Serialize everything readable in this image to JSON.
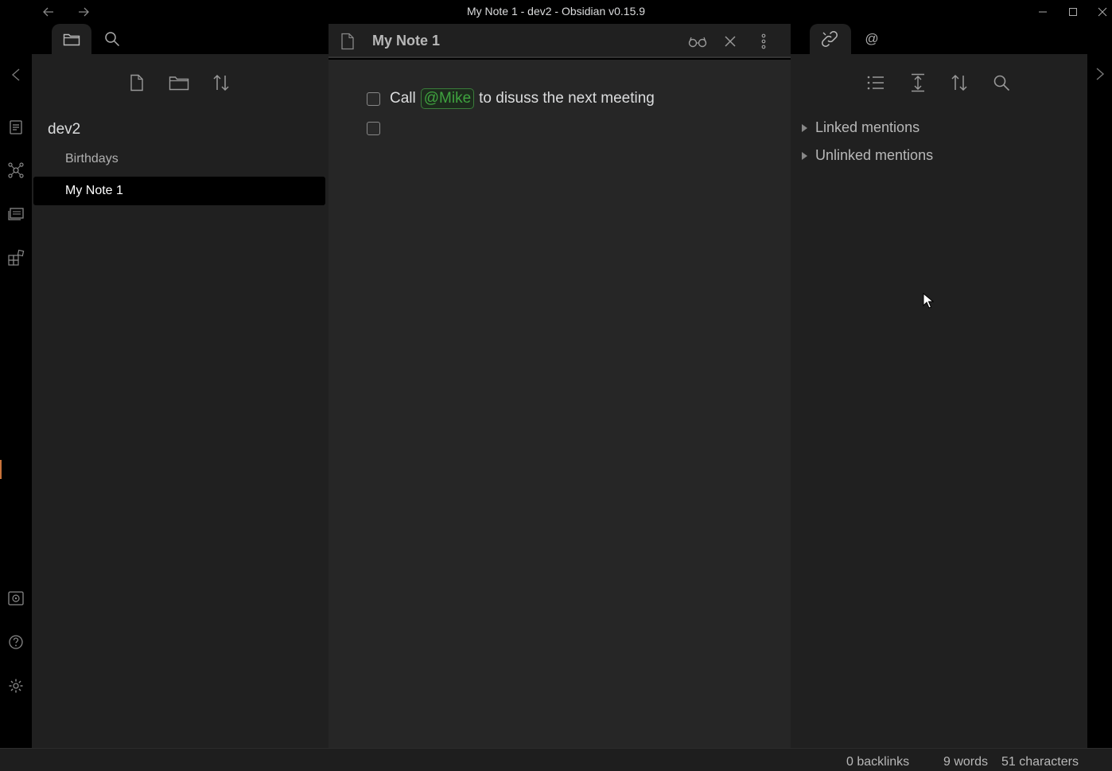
{
  "window": {
    "title": "My Note 1 - dev2 - Obsidian v0.15.9"
  },
  "vault": {
    "name": "dev2",
    "files": [
      {
        "name": "Birthdays",
        "active": false
      },
      {
        "name": "My Note 1",
        "active": true
      }
    ]
  },
  "editor": {
    "tab_title": "My Note 1",
    "tasks": [
      {
        "before": "Call",
        "mention": "@Mike",
        "after": "to disuss the next meeting",
        "checked": false
      },
      {
        "before": "",
        "mention": "",
        "after": "",
        "checked": false
      }
    ]
  },
  "backlinks_panel": {
    "tab_mention_symbol": "@",
    "groups": [
      {
        "label": "Linked mentions"
      },
      {
        "label": "Unlinked mentions"
      }
    ]
  },
  "status": {
    "backlinks": "0 backlinks",
    "words": "9 words",
    "characters": "51 characters"
  },
  "colors": {
    "mention": "#3fa33f",
    "active_file_bg": "#000000",
    "panel_bg": "#202020",
    "editor_bg": "#262626"
  }
}
